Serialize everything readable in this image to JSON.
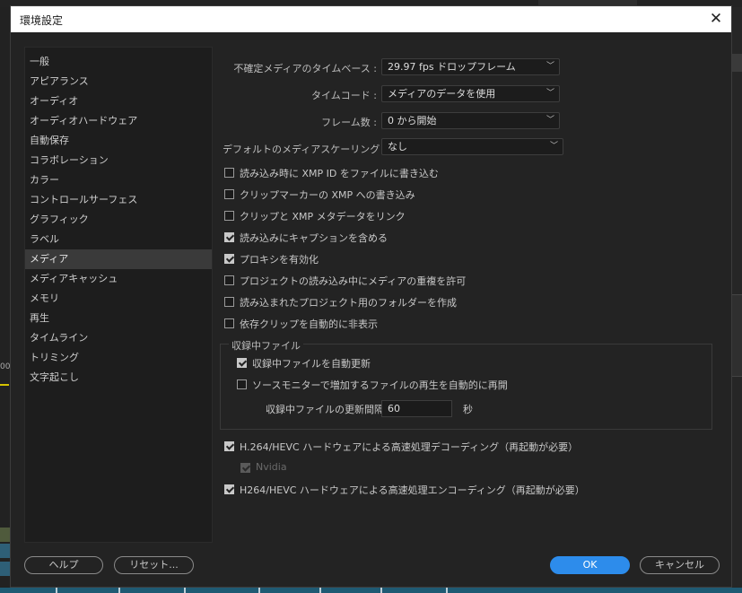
{
  "dialog": {
    "title": "環境設定"
  },
  "sidebar": {
    "items": [
      "一般",
      "アピアランス",
      "オーディオ",
      "オーディオハードウェア",
      "自動保存",
      "コラボレーション",
      "カラー",
      "コントロールサーフェス",
      "グラフィック",
      "ラベル",
      "メディア",
      "メディアキャッシュ",
      "メモリ",
      "再生",
      "タイムライン",
      "トリミング",
      "文字起こし"
    ],
    "selected": "メディア"
  },
  "settings": {
    "timebase": {
      "label": "不確定メディアのタイムベース :",
      "value": "29.97 fps ドロップフレーム"
    },
    "timecode": {
      "label": "タイムコード :",
      "value": "メディアのデータを使用"
    },
    "frame_count": {
      "label": "フレーム数 :",
      "value": "0 から開始"
    },
    "scaling": {
      "label": "デフォルトのメディアスケーリング :",
      "value": "なし"
    }
  },
  "checkboxes": [
    {
      "label": "読み込み時に XMP ID をファイルに書き込む",
      "checked": false
    },
    {
      "label": "クリップマーカーの XMP への書き込み",
      "checked": false
    },
    {
      "label": "クリップと XMP メタデータをリンク",
      "checked": false
    },
    {
      "label": "読み込みにキャプションを含める",
      "checked": true
    },
    {
      "label": "プロキシを有効化",
      "checked": true
    },
    {
      "label": "プロジェクトの読み込み中にメディアの重複を許可",
      "checked": false
    },
    {
      "label": "読み込まれたプロジェクト用のフォルダーを作成",
      "checked": false
    },
    {
      "label": "依存クリップを自動的に非表示",
      "checked": false
    }
  ],
  "growing_files": {
    "title": "収録中ファイル",
    "auto_refresh": {
      "label": "収録中ファイルを自動更新",
      "checked": true
    },
    "auto_resume": {
      "label": "ソースモニターで増加するファイルの再生を自動的に再開",
      "checked": false
    },
    "interval": {
      "label": "収録中ファイルの更新間隔",
      "value": "60",
      "unit": "秒"
    }
  },
  "hardware": {
    "decoding": {
      "label": "H.264/HEVC ハードウェアによる高速処理デコーディング（再起動が必要）",
      "checked": true
    },
    "nvidia": {
      "label": "Nvidia",
      "checked": true
    },
    "encoding": {
      "label": "H264/HEVC ハードウェアによる高速処理エンコーディング（再起動が必要）",
      "checked": true
    }
  },
  "buttons": {
    "help": "ヘルプ",
    "reset": "リセット...",
    "ok": "OK",
    "cancel": "キャンセル"
  },
  "background": {
    "left_text": "00"
  }
}
